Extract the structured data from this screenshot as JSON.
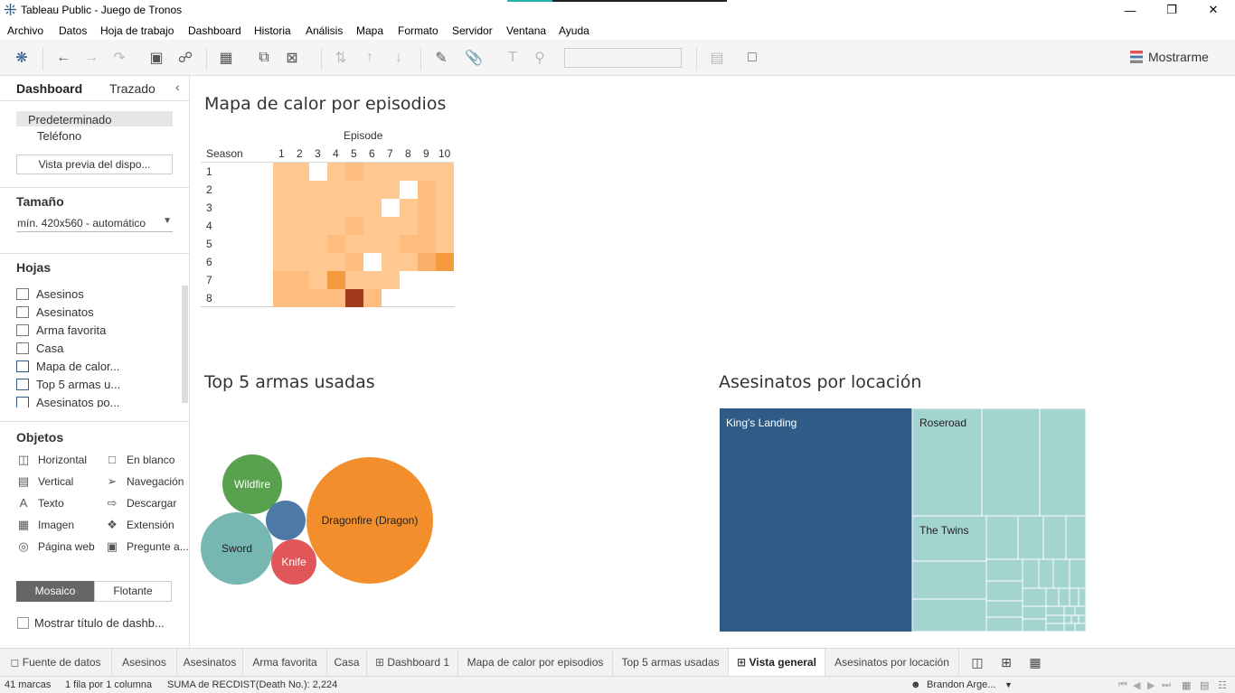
{
  "window": {
    "title": "Tableau Public - Juego de Tronos",
    "controls": [
      "minimize-icon",
      "restore-icon",
      "close-icon"
    ]
  },
  "menu": [
    "Archivo",
    "Datos",
    "Hoja de trabajo",
    "Dashboard",
    "Historia",
    "Análisis",
    "Mapa",
    "Formato",
    "Servidor",
    "Ventana",
    "Ayuda"
  ],
  "toolbar": {
    "show_me": "Mostrarme"
  },
  "left_panel": {
    "tabs": [
      "Dashboard",
      "Trazado"
    ],
    "devices": [
      "Predeterminado",
      "Teléfono"
    ],
    "preview_button": "Vista previa del dispo...",
    "size_heading": "Tamaño",
    "size_value": "mín. 420x560 - automático",
    "sheets_heading": "Hojas",
    "sheets": [
      "Asesinos",
      "Asesinatos",
      "Arma favorita",
      "Casa",
      "Mapa de calor...",
      "Top 5 armas u...",
      "Asesinatos po..."
    ],
    "objects_heading": "Objetos",
    "objects": [
      {
        "label": "Horizontal",
        "icon": "horizontal-icon"
      },
      {
        "label": "En blanco",
        "icon": "blank-icon"
      },
      {
        "label": "Vertical",
        "icon": "vertical-icon"
      },
      {
        "label": "Navegación",
        "icon": "navigation-icon"
      },
      {
        "label": "Texto",
        "icon": "text-icon"
      },
      {
        "label": "Descargar",
        "icon": "download-icon"
      },
      {
        "label": "Imagen",
        "icon": "image-icon"
      },
      {
        "label": "Extensión",
        "icon": "extension-icon"
      },
      {
        "label": "Página web",
        "icon": "web-page-icon"
      },
      {
        "label": "Pregunte a...",
        "icon": "ask-data-icon"
      }
    ],
    "layout_modes": [
      "Mosaico",
      "Flotante"
    ],
    "show_title": "Mostrar título de dashb..."
  },
  "heatmap": {
    "title": "Mapa de calor por episodios",
    "col_header": "Episode",
    "row_header": "Season",
    "episodes": [
      "1",
      "2",
      "3",
      "4",
      "5",
      "6",
      "7",
      "8",
      "9",
      "10"
    ],
    "seasons": [
      "1",
      "2",
      "3",
      "4",
      "5",
      "6",
      "7",
      "8"
    ]
  },
  "bubbles": {
    "title": "Top 5 armas usadas",
    "labels": [
      "Wildfire",
      "Sword",
      "Knife",
      "Dragonfire (Dragon)"
    ]
  },
  "treemap": {
    "title": "Asesinatos por locación",
    "labels": [
      "King's Landing",
      "Roseroad",
      "The Twins"
    ]
  },
  "bottom_tabs": [
    "Fuente de datos",
    "Asesinos",
    "Asesinatos",
    "Arma favorita",
    "Casa",
    "Dashboard 1",
    "Mapa de calor por episodios",
    "Top 5 armas usadas",
    "Vista general",
    "Asesinatos por locación"
  ],
  "status": {
    "marks": "41 marcas",
    "rows": "1 fila por 1 columna",
    "sum": "SUMA de RECDIST(Death No.): 2,224",
    "user": "Brandon Arge..."
  },
  "colors": {
    "heat_light": "#ffc891",
    "heat_dark": "#a23a1e",
    "kings_landing": "#2f5b87",
    "treemap_teal": "#a3d4d0",
    "wildfire": "#59a14f",
    "sword": "#76b7b2",
    "knife": "#e15759",
    "dragonfire": "#f28e2b",
    "other": "#4e79a7"
  }
}
